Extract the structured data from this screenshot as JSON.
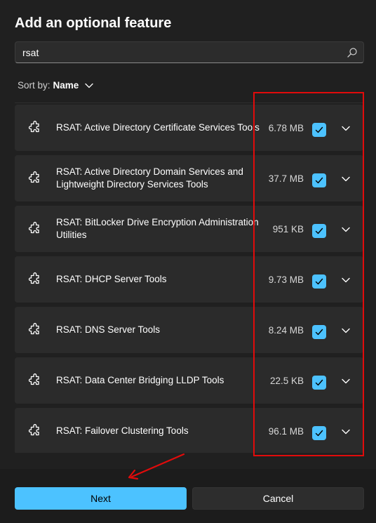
{
  "dialog": {
    "title": "Add an optional feature"
  },
  "search": {
    "value": "rsat",
    "icon": "search-icon"
  },
  "sort": {
    "label": "Sort by:",
    "value": "Name",
    "icon": "chevron-down-icon"
  },
  "features": [
    {
      "name": "RSAT: Active Directory Certificate Services Tools",
      "size": "6.78 MB",
      "checked": true
    },
    {
      "name": "RSAT: Active Directory Domain Services and Lightweight Directory Services Tools",
      "size": "37.7 MB",
      "checked": true
    },
    {
      "name": "RSAT: BitLocker Drive Encryption Administration Utilities",
      "size": "951 KB",
      "checked": true
    },
    {
      "name": "RSAT: DHCP Server Tools",
      "size": "9.73 MB",
      "checked": true
    },
    {
      "name": "RSAT: DNS Server Tools",
      "size": "8.24 MB",
      "checked": true
    },
    {
      "name": "RSAT: Data Center Bridging LLDP Tools",
      "size": "22.5 KB",
      "checked": true
    },
    {
      "name": "RSAT: Failover Clustering Tools",
      "size": "96.1 MB",
      "checked": true
    }
  ],
  "buttons": {
    "next": "Next",
    "cancel": "Cancel"
  },
  "colors": {
    "accent": "#4cc2ff",
    "annotation": "#e10b0b",
    "background": "#202020",
    "row": "#2b2b2b"
  }
}
